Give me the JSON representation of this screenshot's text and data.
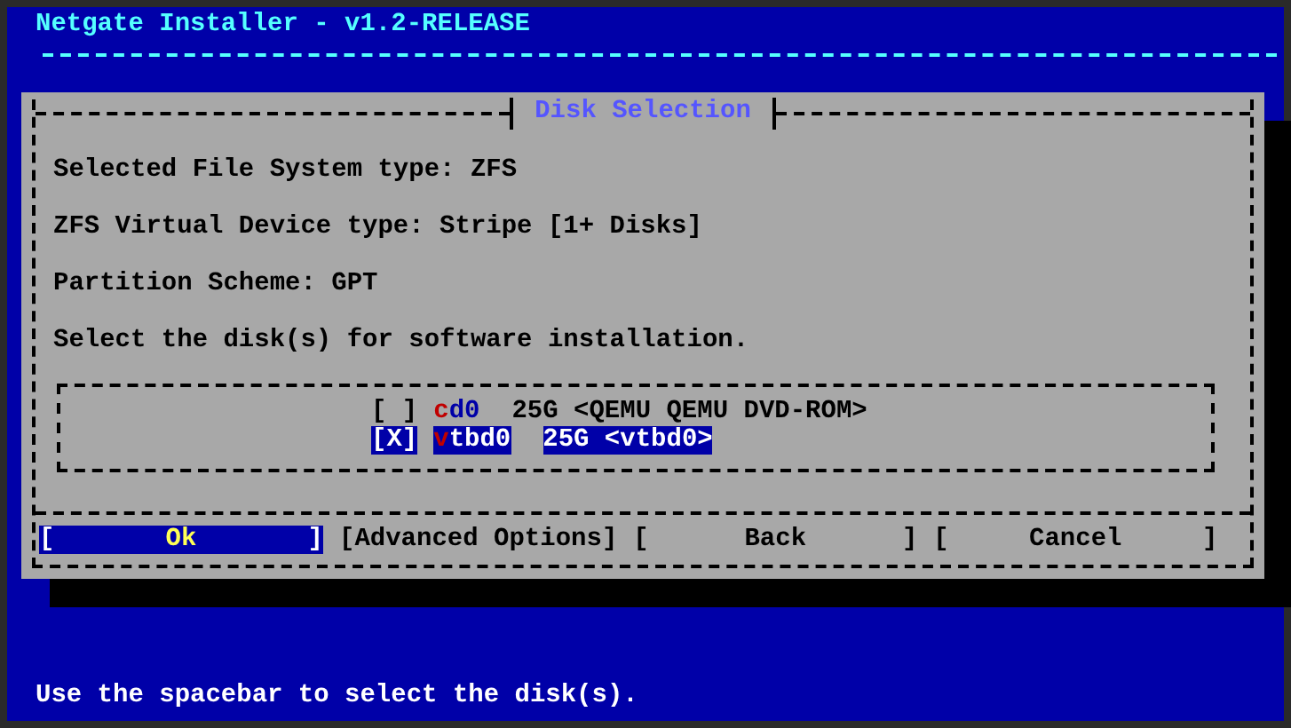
{
  "window": {
    "title": "Netgate Installer - v1.2-RELEASE"
  },
  "dialog": {
    "title": "Disk Selection",
    "lines": [
      "Selected File System type: ZFS",
      "ZFS Virtual Device type: Stripe [1+ Disks]",
      "Partition Scheme: GPT",
      "Select the disk(s) for software installation."
    ],
    "checkbox": {
      "open": "[",
      "close": "]",
      "mark": "X"
    },
    "disks": [
      {
        "name": "cd0",
        "description": "25G <QEMU QEMU DVD-ROM>",
        "checked": false,
        "selected": false
      },
      {
        "name": "vtbd0",
        "description": "25G <vtbd0>",
        "checked": true,
        "selected": true
      }
    ],
    "buttons": [
      {
        "open": "[",
        "label": "Ok",
        "close": "]",
        "kind": "padded",
        "selected": true
      },
      {
        "open": "[",
        "label": "Advanced Options",
        "close": "]",
        "kind": "tight",
        "selected": false
      },
      {
        "open": "[",
        "label": "Back",
        "close": "]",
        "kind": "padded",
        "selected": false
      },
      {
        "open": "[",
        "label": "Cancel",
        "close": "]",
        "kind": "padded",
        "selected": false
      }
    ]
  },
  "status_bar": "Use the spacebar to select the disk(s)."
}
